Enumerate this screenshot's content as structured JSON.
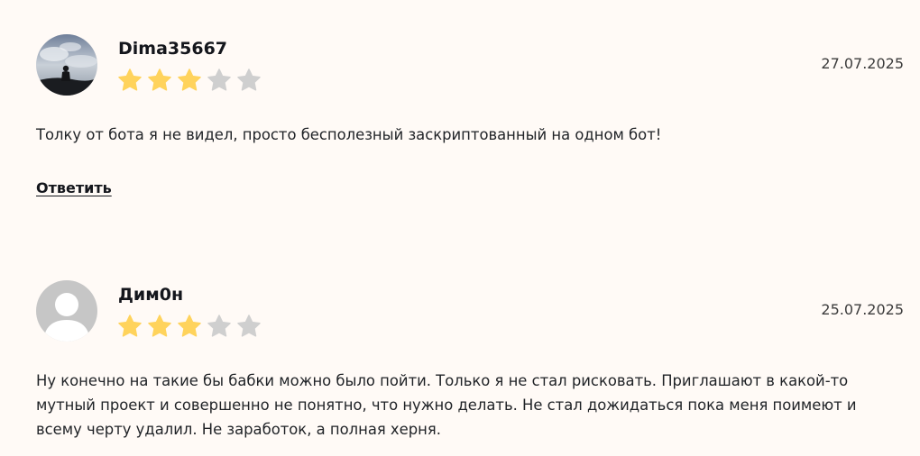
{
  "reviews": [
    {
      "author": "Dima35667",
      "date": "27.07.2025",
      "rating": 3,
      "max_rating": 5,
      "text": "Толку от бота я не видел, просто бесполезный заскриптованный на одном бот!",
      "reply_label": "Ответить",
      "avatar": "photo-avatar"
    },
    {
      "author": "Дим0н",
      "date": "25.07.2025",
      "rating": 3,
      "max_rating": 5,
      "text": "Ну конечно на такие бы бабки можно было пойти. Только я не стал рисковать. Приглашают в какой-то мутный проект и совершенно не понятно, что нужно делать. Не стал дожидаться пока меня поимеют и всему черту удалил. Не заработок, а полная херня.",
      "avatar": "default-user-avatar"
    }
  ],
  "colors": {
    "star_filled": "#ffd35c",
    "star_empty": "#cfcfcf",
    "background": "#fffaf6"
  }
}
